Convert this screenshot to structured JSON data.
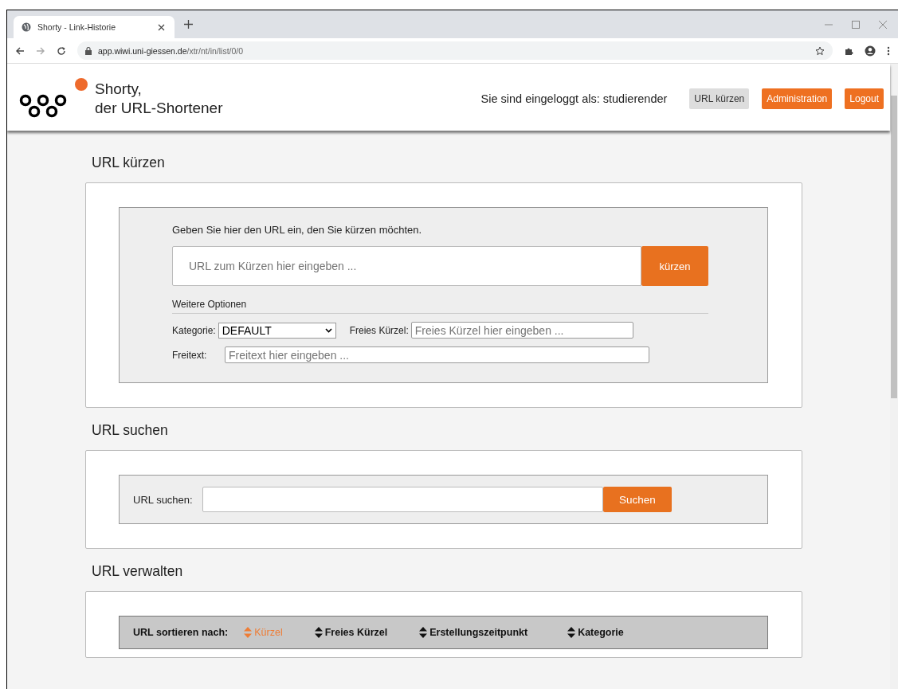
{
  "browser": {
    "tab_title": "Shorty - Link-Historie",
    "url_host": "app.wiwi.uni-giessen.de",
    "url_path": "/xtr/nt/in/list/0/0"
  },
  "header": {
    "title_line1": "Shorty,",
    "title_line2": "der URL-Shortener",
    "login_text": "Sie sind eingeloggt als: studierender",
    "nav": [
      {
        "label": "URL kürzen",
        "selected": true
      },
      {
        "label": "Administration",
        "selected": false
      },
      {
        "label": "Logout",
        "selected": false
      }
    ]
  },
  "shorten": {
    "heading": "URL kürzen",
    "intro": "Geben Sie hier den URL ein, den Sie kürzen möchten.",
    "placeholder": "URL zum Kürzen hier eingeben ...",
    "button": "kürzen",
    "options_title": "Weitere Optionen",
    "category_label": "Kategorie:",
    "category_value": "DEFAULT",
    "alias_label": "Freies Kürzel:",
    "alias_placeholder": "Freies Kürzel hier eingeben ...",
    "freetext_label": "Freitext:",
    "freetext_placeholder": "Freitext hier eingeben ..."
  },
  "search": {
    "heading": "URL suchen",
    "label": "URL suchen:",
    "button": "Suchen"
  },
  "manage": {
    "heading": "URL verwalten",
    "sort_label": "URL sortieren nach:",
    "sort_options": [
      {
        "label": "Kürzel",
        "selected": true
      },
      {
        "label": "Freies Kürzel",
        "selected": false
      },
      {
        "label": "Erstellungszeitpunkt",
        "selected": false
      },
      {
        "label": "Kategorie",
        "selected": false
      }
    ]
  }
}
